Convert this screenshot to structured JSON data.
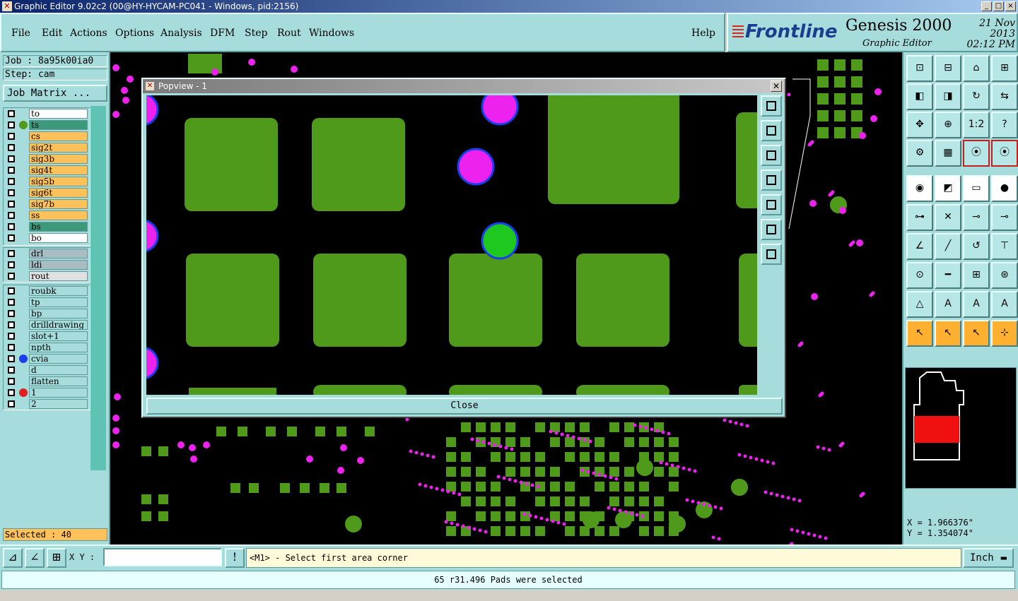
{
  "window": {
    "title": "Graphic Editor 9.02c2 (00@HY-HYCAM-PC041 - Windows, pid:2156)",
    "app_icon": "x-icon",
    "controls": [
      "_",
      "□",
      "×"
    ]
  },
  "menu": {
    "items": [
      "File",
      "Edit",
      "Actions",
      "Options",
      "Analysis",
      "DFM",
      "Step",
      "Rout",
      "Windows"
    ],
    "help": "Help"
  },
  "brand": {
    "logo": "Frontline",
    "product": "Genesis 2000",
    "subtitle": "Graphic Editor",
    "date": "21 Nov 2013",
    "time": "02:12 PM",
    "accent": "#d8281e",
    "logo_color": "#1a3d8f"
  },
  "job": {
    "job_label": "Job : 8a95k00ia0",
    "step_label": "Step: cam",
    "matrix_button": "Job Matrix ..."
  },
  "layers": {
    "board": [
      {
        "name": "to",
        "bg": "#ffffff",
        "dot": ""
      },
      {
        "name": "ts",
        "bg": "#3c9a7a",
        "dot": "#4f9a1a"
      },
      {
        "name": "cs",
        "bg": "#ffc25a",
        "dot": ""
      },
      {
        "name": "sig2t",
        "bg": "#ffc25a",
        "dot": ""
      },
      {
        "name": "sig3b",
        "bg": "#ffc25a",
        "dot": ""
      },
      {
        "name": "sig4t",
        "bg": "#ffc25a",
        "dot": ""
      },
      {
        "name": "sig5b",
        "bg": "#ffc25a",
        "dot": ""
      },
      {
        "name": "sig6t",
        "bg": "#ffc25a",
        "dot": ""
      },
      {
        "name": "sig7b",
        "bg": "#ffc25a",
        "dot": ""
      },
      {
        "name": "ss",
        "bg": "#ffc25a",
        "dot": ""
      },
      {
        "name": "bs",
        "bg": "#3c9a7a",
        "dot": ""
      },
      {
        "name": "bo",
        "bg": "#ffffff",
        "dot": ""
      }
    ],
    "drill": [
      {
        "name": "drl",
        "bg": "#a8bcc4",
        "dot": ""
      },
      {
        "name": "ldi",
        "bg": "#a8bcc4",
        "dot": ""
      },
      {
        "name": "rout",
        "bg": "#e0e0e0",
        "dot": ""
      }
    ],
    "misc": [
      {
        "name": "roubk",
        "bg": "#a6dcdc",
        "dot": ""
      },
      {
        "name": "tp",
        "bg": "#a6dcdc",
        "dot": ""
      },
      {
        "name": "bp",
        "bg": "#a6dcdc",
        "dot": ""
      },
      {
        "name": "drilldrawing",
        "bg": "#a6dcdc",
        "dot": ""
      },
      {
        "name": "slot+1",
        "bg": "#a6dcdc",
        "dot": ""
      },
      {
        "name": "npth",
        "bg": "#a6dcdc",
        "dot": ""
      },
      {
        "name": "cvia",
        "bg": "#a6dcdc",
        "dot": "#1a3dee"
      },
      {
        "name": "d",
        "bg": "#a6dcdc",
        "dot": ""
      },
      {
        "name": "flatten",
        "bg": "#a6dcdc",
        "dot": ""
      },
      {
        "name": "1",
        "bg": "#a6dcdc",
        "dot": "#e02020"
      },
      {
        "name": "2",
        "bg": "#a6dcdc",
        "dot": ""
      }
    ]
  },
  "selected": "Selected : 40",
  "popview": {
    "title": "Popview - 1",
    "close": "Close"
  },
  "toolbox": {
    "rows": [
      [
        "⊡",
        "⊟",
        "⌂",
        "⊞"
      ],
      [
        "◧",
        "◨",
        "↻",
        "⇆"
      ],
      [
        "✥",
        "⊕",
        "1:2",
        "?"
      ],
      [
        "⚙",
        "▦",
        "⦿",
        "⦿"
      ],
      [
        "◉",
        "◩",
        "▭",
        "●"
      ],
      [
        "⊶",
        "✕",
        "⊸",
        "⊸"
      ],
      [
        "∠",
        "╱",
        "↺",
        "⊤"
      ],
      [
        "⊙",
        "━",
        "⊞",
        "⊛"
      ],
      [
        "△",
        "A",
        "A",
        "A"
      ],
      [
        "↖",
        "↖",
        "↖",
        "⊹"
      ]
    ]
  },
  "coords": {
    "x": "X = 1.966376\"",
    "y": "Y = 1.354074\""
  },
  "cmd": {
    "xy_label": "X Y :",
    "xy_value": "",
    "prompt": "<M1> - Select first area corner",
    "unit": "Inch",
    "bang": "!"
  },
  "status": "65 r31.496 Pads were selected",
  "colors": {
    "pad_green": "#4f9a1a",
    "via_magenta": "#ee22ee",
    "via_ring": "#1a3dee",
    "panel_teal": "#a6dcdc"
  }
}
